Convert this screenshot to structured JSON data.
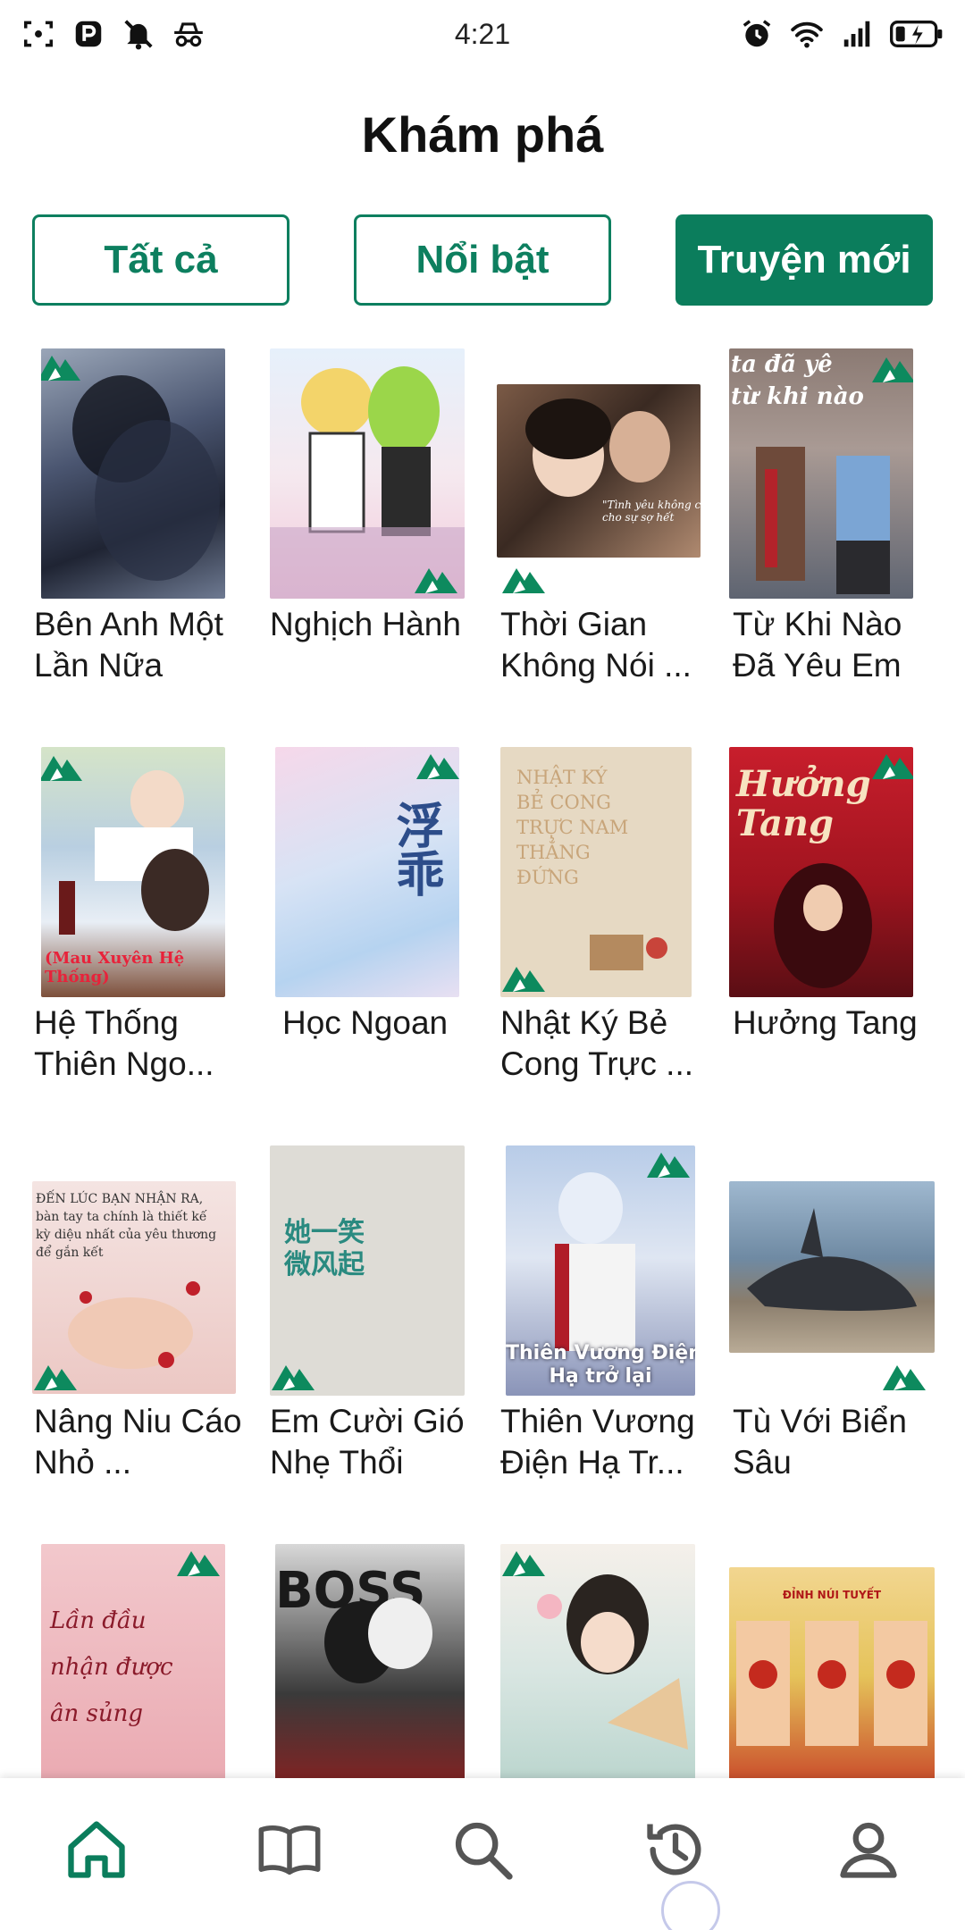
{
  "status_bar": {
    "time": "4:21",
    "left_icons": [
      "screenshot-icon",
      "parking-app-icon",
      "notifications-muted-icon",
      "incognito-icon"
    ],
    "right_icons": [
      "alarm-icon",
      "wifi-icon",
      "signal-icon",
      "battery-charging-icon"
    ]
  },
  "header": {
    "title": "Khám phá"
  },
  "filters": [
    {
      "label": "Tất cả",
      "selected": false
    },
    {
      "label": "Nổi bật",
      "selected": false
    },
    {
      "label": "Truyện mới",
      "selected": true
    }
  ],
  "colors": {
    "accent": "#0b7d5c",
    "text": "#1a1a1a",
    "background": "#ffffff"
  },
  "books": [
    {
      "title": "Bên Anh Một Lần Nữa"
    },
    {
      "title": "Nghịch Hành"
    },
    {
      "title": "Thời Gian Không Nói ...",
      "cover_text": "\"Tình yêu không c\ncho sự sợ hết"
    },
    {
      "title": "Từ Khi Nào Đã Yêu Em",
      "cover_text": "ta đã yê\ntừ khi nào"
    },
    {
      "title": "Hệ Thống Thiên Ngo...",
      "cover_text": "(Mau Xuyên Hệ Thống)"
    },
    {
      "title": "Học Ngoan",
      "cover_text": "浮乖"
    },
    {
      "title": "Nhật Ký Bẻ Cong Trực ...",
      "cover_text": "NHẬT KÝ\nBẺ CONG\nTRỰC NAM\nTHẲNG\nĐỨNG"
    },
    {
      "title": "Hưởng Tang",
      "cover_text": "Hưởng\nTang"
    },
    {
      "title": "Nâng Niu Cáo Nhỏ ...",
      "cover_text": "ĐẾN LÚC BẠN NHẬN RA,\nbàn tay ta chính là thiết kế\nkỳ diệu nhất của yêu thương\nđể gắn kết"
    },
    {
      "title": "Em Cười Gió Nhẹ Thổi",
      "cover_text": "她一笑 微风起"
    },
    {
      "title": "Thiên Vương Điện Hạ Tr...",
      "cover_text": "Thiên Vương Điện\nHạ trở lại"
    },
    {
      "title": "Tù Với Biển Sâu"
    },
    {
      "title": "",
      "cover_text": "Lần đầu\nnhận được\nân sủng"
    },
    {
      "title": "",
      "cover_text": "BOSS"
    },
    {
      "title": ""
    },
    {
      "title": "",
      "cover_text": "ĐỈNH NÚI TUYẾT"
    }
  ],
  "bottom_nav": [
    {
      "icon": "home-icon",
      "active": true
    },
    {
      "icon": "book-icon",
      "active": false
    },
    {
      "icon": "search-icon",
      "active": false
    },
    {
      "icon": "history-icon",
      "active": false
    },
    {
      "icon": "profile-icon",
      "active": false
    }
  ]
}
